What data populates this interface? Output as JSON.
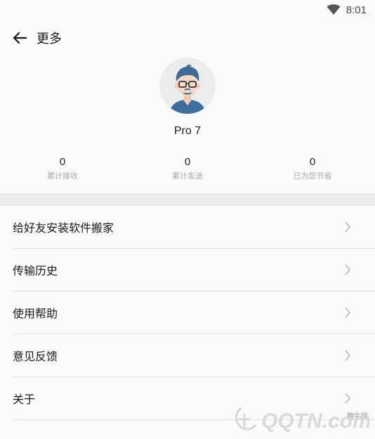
{
  "status_bar": {
    "time": "8:01",
    "wifi_icon": "wifi-icon"
  },
  "app_bar": {
    "title": "更多",
    "back_icon": "arrow-left-icon"
  },
  "profile": {
    "device_name": "Pro 7",
    "avatar_icon": "avatar-illustration"
  },
  "stats": [
    {
      "value": "0",
      "label": "累计接收"
    },
    {
      "value": "0",
      "label": "累计发送"
    },
    {
      "value": "0",
      "label": "已为您节省"
    }
  ],
  "menu": [
    {
      "label": "给好友安装软件搬家"
    },
    {
      "label": "传输历史"
    },
    {
      "label": "使用帮助"
    },
    {
      "label": "意见反馈"
    },
    {
      "label": "关于"
    }
  ],
  "watermark": {
    "top_text": "腾牛网",
    "logo_text": "QQTN.com"
  },
  "colors": {
    "background": "#fafafa",
    "divider_band": "#ececec",
    "muted_text": "#aaaaaa"
  }
}
